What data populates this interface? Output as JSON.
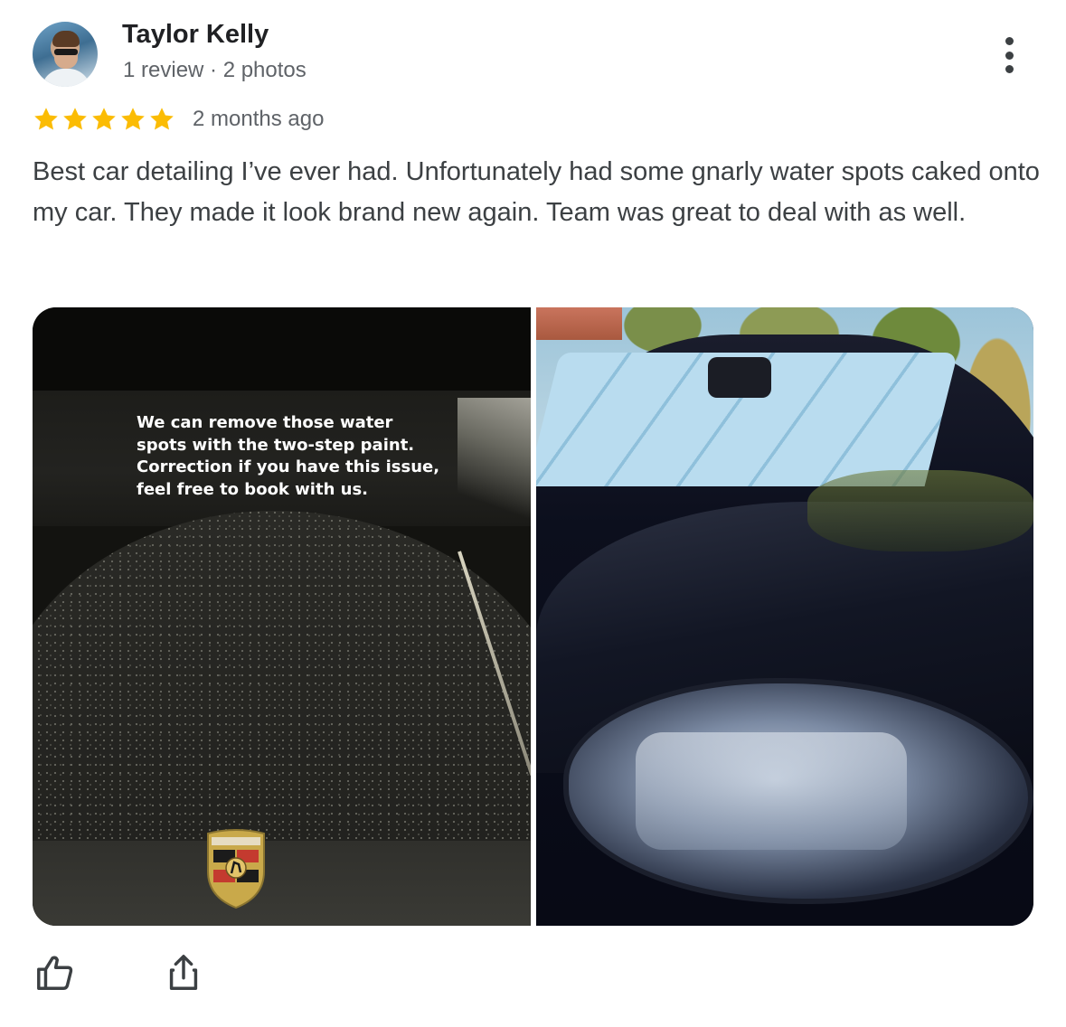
{
  "reviewer": {
    "name": "Taylor Kelly",
    "meta": "1 review · 2 photos"
  },
  "rating": {
    "stars": 5,
    "max": 5,
    "date": "2 months ago"
  },
  "review_text": "Best car detailing I’ve ever had. Unfortunately had some gnarly water spots caked onto my car. They made it look brand new again. Team was great to deal with as well.",
  "photos": [
    {
      "overlay_lines": [
        "We can remove those water",
        "spots with the two-step paint.",
        "Correction if you have this issue,",
        "feel free to book with us."
      ]
    },
    {
      "overlay_lines": []
    }
  ],
  "actions": {
    "like_icon": "thumb-up-icon",
    "share_icon": "share-icon"
  },
  "colors": {
    "star": "#fbbc04",
    "secondary_text": "#5f6368",
    "body_text": "#3c4043"
  }
}
